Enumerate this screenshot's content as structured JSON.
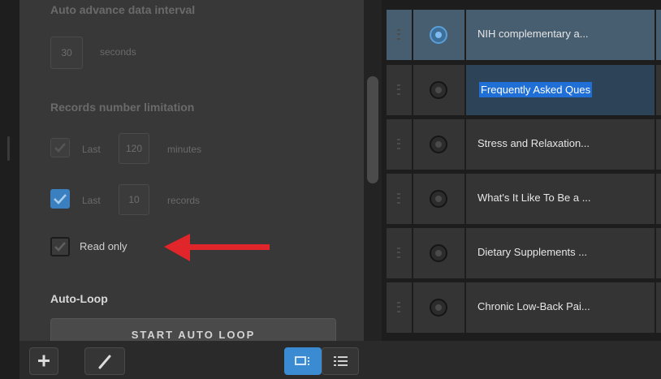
{
  "settings": {
    "auto_advance_label": "Auto advance data interval",
    "interval_value": "30",
    "interval_unit": "seconds",
    "records_limitation_label": "Records number limitation",
    "last_minutes": {
      "prefix": "Last",
      "value": "120",
      "unit": "minutes",
      "checked": true
    },
    "last_records": {
      "prefix": "Last",
      "value": "10",
      "unit": "records",
      "checked": true
    },
    "read_only": {
      "label": "Read only",
      "checked": false
    },
    "auto_loop_label": "Auto-Loop",
    "start_auto_loop_label": "START AUTO LOOP"
  },
  "rows": [
    {
      "title": "NIH complementary a...",
      "selected": true
    },
    {
      "title": "Frequently Asked Ques",
      "selected": false,
      "editing": true
    },
    {
      "title": "Stress and Relaxation...",
      "selected": false
    },
    {
      "title": "What's It Like To Be a ...",
      "selected": false
    },
    {
      "title": "Dietary Supplements ...",
      "selected": false
    },
    {
      "title": "Chronic Low-Back Pai...",
      "selected": false
    }
  ],
  "toolbar": {
    "add_icon": "plus-icon",
    "edit_icon": "pencil-icon",
    "grid_view_icon": "grid-view-icon",
    "list_view_icon": "list-view-icon"
  },
  "colors": {
    "accent": "#3a8bd1",
    "selected_row": "#475d70",
    "arrow": "#e0262a",
    "edit_highlight": "#1f6fd6"
  }
}
